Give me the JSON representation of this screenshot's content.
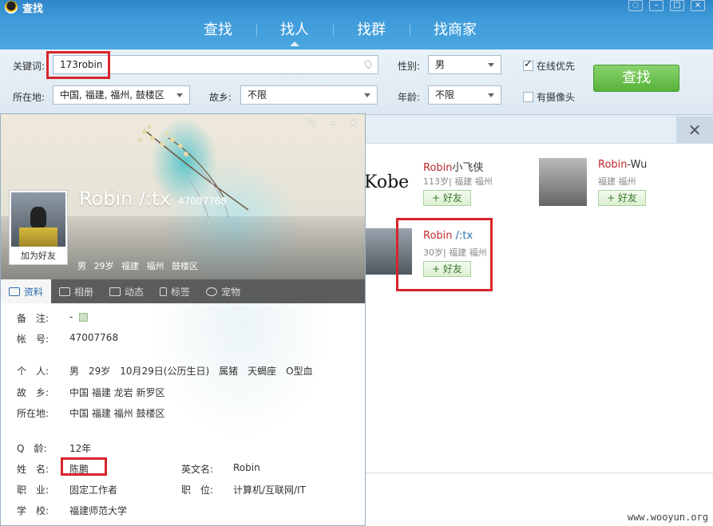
{
  "window": {
    "title": "查找"
  },
  "tabs": [
    {
      "label": "查找"
    },
    {
      "label": "找人"
    },
    {
      "label": "找群"
    },
    {
      "label": "找商家"
    }
  ],
  "search": {
    "keyword_label": "关键词:",
    "keyword_value": "173robin",
    "location_label": "所在地:",
    "location_value": "中国, 福建, 福州, 鼓楼区",
    "hometown_label": "故乡:",
    "hometown_value": "不限",
    "gender_label": "性别:",
    "gender_value": "男",
    "age_label": "年龄:",
    "age_value": "不限",
    "online_first_label": "在线优先",
    "online_first_checked": true,
    "has_camera_label": "有摄像头",
    "has_camera_checked": false,
    "search_button": "查找"
  },
  "results": [
    {
      "name_hl": "Robin",
      "name_rest": "小飞侠",
      "info": "113岁| 福建 福州",
      "add": "+ 好友"
    },
    {
      "name_hl": "Robin",
      "name_rest": "-Wu",
      "info": "福建 福州",
      "add": "+ 好友"
    },
    {
      "name_hl": "Robin",
      "name_rest": " /:tx",
      "info": "30岁| 福建 福州",
      "add": "+ 好友"
    }
  ],
  "result_partial_text": "Kobe",
  "watermark": "www.wooyun.org",
  "profile": {
    "name": "Robin /:tx",
    "qq": "47007768",
    "add_friend": "加为好友",
    "basic": "男  29岁  福建 福州 鼓楼区",
    "tabs": [
      "资料",
      "相册",
      "动态",
      "标签",
      "宠物"
    ],
    "fields": {
      "remark_label": "备　注:",
      "remark_value": "-",
      "account_label": "帐　号:",
      "account_value": "47007768",
      "personal_label": "个　人:",
      "personal_value": "男　29岁　10月29日(公历生日)　属猪　天蝎座　O型血",
      "hometown_label": "故　乡:",
      "hometown_value": "中国 福建 龙岩 新罗区",
      "location_label": "所在地:",
      "location_value": "中国 福建 福州 鼓楼区",
      "qage_label": "Q　龄:",
      "qage_value": "12年",
      "realname_label": "姓　名:",
      "realname_value": "陈鹏",
      "engname_label": "英文名:",
      "engname_value": "Robin",
      "job_label": "职　业:",
      "job_value": "固定工作者",
      "position_label": "职　位:",
      "position_value": "计算机/互联网/IT",
      "school_label": "学　校:",
      "school_value": "福建师范大学"
    }
  },
  "colors": {
    "accent": "#3f9bd9",
    "highlight_box": "#d9252a",
    "search_button": "#58b33b"
  }
}
